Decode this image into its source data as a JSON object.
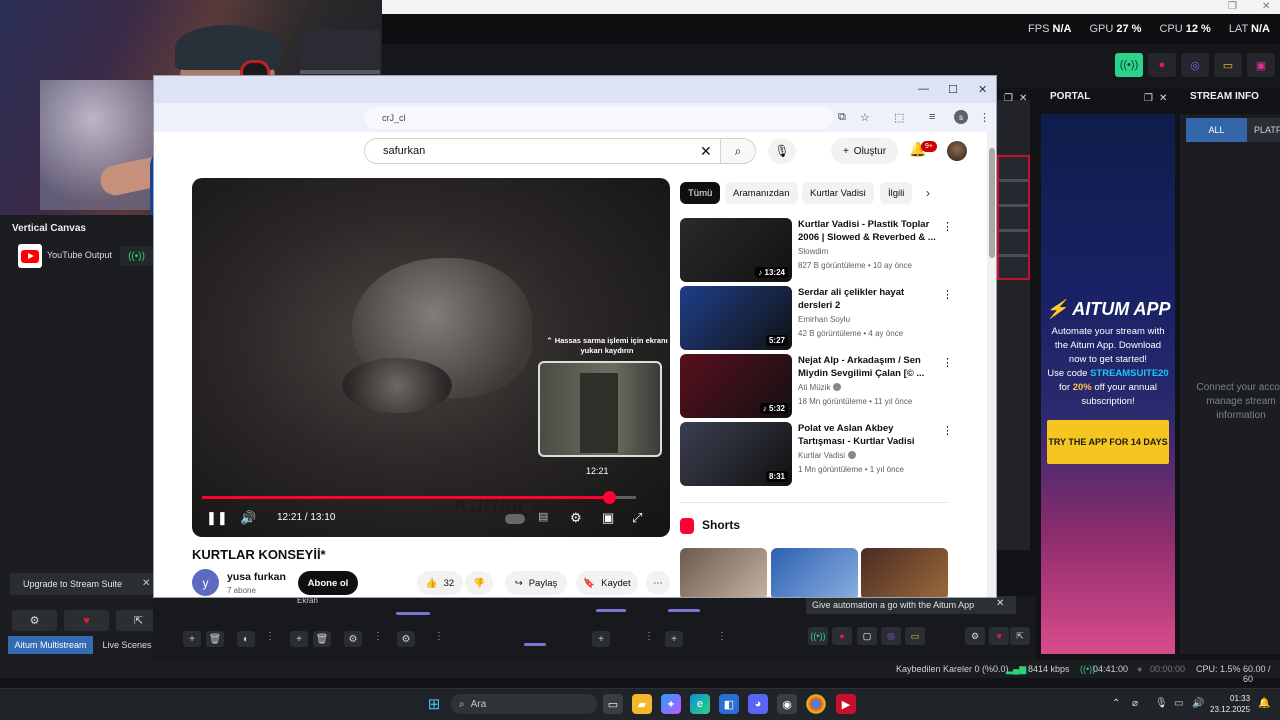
{
  "obs": {
    "stats": {
      "fps_label": "FPS",
      "fps_value": "N/A",
      "gpu_label": "GPU",
      "gpu_value": "27 %",
      "cpu_label": "CPU",
      "cpu_value": "12 %",
      "lat_label": "LAT",
      "lat_value": "N/A"
    },
    "vertical_canvas": {
      "title": "Vertical Canvas",
      "output_label": "YouTube Output"
    },
    "upgrade_label": "Upgrade to Stream Suite",
    "tabs": [
      "Aitum Multistream",
      "Live Scenes"
    ],
    "ekran_label": "Ekran",
    "automation_tip": "Give automation a go with the Aitum App",
    "docks": {
      "portal_title": "PORTAL",
      "stream_info_title": "STREAM INFO"
    },
    "aitum_ad": {
      "logo": "AITUM APP",
      "text_1": "Automate your stream with the Aitum App. Download now to get started!",
      "text_2": "Use code",
      "code": "STREAMSUITE20",
      "text_3": "for",
      "discount": "20%",
      "text_4": "off your annual subscription!",
      "cta": "TRY THE APP FOR 14 DAYS"
    },
    "stream_info": {
      "tab_all": "ALL",
      "tab_platform": "PLATFO",
      "message": "Connect your accou manage stream information"
    },
    "status_bar": {
      "dropped_frames": "Kaybedilen Kareler 0 (%0.0)",
      "bitrate": "8414 kbps",
      "stream_time": "04:41:00",
      "rec_time": "00:00:00",
      "cpu": "CPU: 1.5%",
      "fps": "60.00 / 60"
    }
  },
  "browser": {
    "url": "crJ_cl",
    "search_query": "safurkan",
    "create_label": "Oluştur",
    "notif_badge": "9+",
    "profile_initial": "s"
  },
  "player": {
    "hint": "Hassas sarma işlemi için ekranı yukarı kaydırın",
    "preview_time": "12:21",
    "current_time": "12:21",
    "duration": "13:10",
    "progress": 0.9379,
    "watermark": "Kurtlar Konseyi"
  },
  "video": {
    "title": "KURTLAR KONSEYİİ*",
    "channel": "yusa furkan",
    "channel_initial": "y",
    "subscribers": "7 abone",
    "subscribe_label": "Abone ol",
    "likes": "32",
    "share_label": "Paylaş",
    "save_label": "Kaydet"
  },
  "chips": [
    "Tümü",
    "Aramanızdan",
    "Kurtlar Vadisi",
    "İlgili"
  ],
  "recommendations": [
    {
      "title": "Kurtlar Vadisi - Plastik Toplar 2006 | Slowed & Reverbed & ...",
      "channel": "Slowdim",
      "meta": "827 B görüntüleme • 10 ay önce",
      "duration": "13:24",
      "thumb_color": "#2a2a2a"
    },
    {
      "title": "Serdar ali çelikler hayat dersleri 2",
      "channel": "Emirhan Soylu",
      "meta": "42 B görüntüleme • 4 ay önce",
      "duration": "5:27",
      "thumb_color": "#1f3f8a"
    },
    {
      "title": "Nejat Alp - Arkadaşım / Sen Miydin Sevgilimi Çalan  [© ...",
      "channel": "Ati Müzik",
      "meta": "18 Mn görüntüleme • 11 yıl önce",
      "duration": "5:32",
      "thumb_color": "#5a0f1e"
    },
    {
      "title": "Polat ve Aslan Akbey Tartışması - Kurtlar Vadisi",
      "channel": "Kurtlar Vadisi",
      "meta": "1 Mn görüntüleme • 1 yıl önce",
      "duration": "8:31",
      "thumb_color": "#3c3f52"
    }
  ],
  "shorts_title": "Shorts",
  "taskbar": {
    "search_placeholder": "Ara",
    "time": "01:33",
    "date": "23.12.2025"
  }
}
